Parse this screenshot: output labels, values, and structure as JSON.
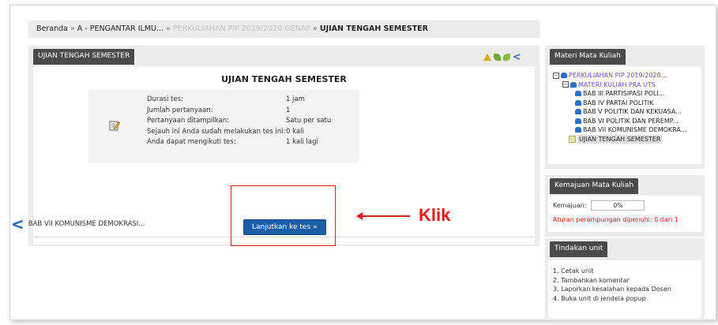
{
  "breadcrumb": {
    "home": "Beranda",
    "sep": "»",
    "course": "A - PENGANTAR ILMU...",
    "period": "PERKULIAHAN PIP 2019/2020 GENAP",
    "current": "UJIAN TENGAH SEMESTER"
  },
  "main": {
    "tab_label": "UJIAN TENGAH SEMESTER",
    "title": "UJIAN TENGAH SEMESTER",
    "info_rows": [
      {
        "label": "Durasi tes:",
        "value": "1 jam"
      },
      {
        "label": "Jumlah pertanyaan:",
        "value": "1"
      },
      {
        "label": "Pertanyaan ditampilkan:",
        "value": "Satu per satu"
      },
      {
        "label": "Sejauh ini Anda sudah melakukan tes ini:",
        "value": "0 kali"
      },
      {
        "label": "Anda dapat mengikuti tes:",
        "value": "1 kali lagi"
      }
    ],
    "start_button": "Lanjutkan ke tes »",
    "prev_link": "BAB VII KOMUNISME DEMOKRASI..."
  },
  "annotation": {
    "text": "Klik",
    "color": "#e31b1b"
  },
  "sidebar": {
    "materials_title": "Materi Mata Kuliah",
    "tree": {
      "root": "PERKULIAHAN PIP 2019/2020...",
      "folder": "MATERI KULIAH PRA UTS",
      "items": [
        "BAB III PARTISIPASI POLI...",
        "BAB IV PARTAI POLITIK",
        "BAB V POLITIK DAN KEKUASA...",
        "BAB VI POLITIK DAN PEREMP...",
        "BAB VII KOMUNISME DEMOKRA..."
      ],
      "current": "UJIAN TENGAH SEMESTER"
    },
    "progress_title": "Kemajuan Mata Kuliah",
    "progress_label": "Kemajuan:",
    "progress_value": "0%",
    "progress_rule": "Aturan perampungan dipenuhi: 0 dari 1",
    "actions_title": "Tindakan unit",
    "actions": [
      "1. Cetak unit",
      "2. Tambahkan komentar",
      "3. Laporkan kesalahan kepada Dosen",
      "4. Buka unit di jendela popup"
    ]
  },
  "colors": {
    "accent": "#1b5ea8",
    "header_tab": "#4a4a4a",
    "annotation": "#e31b1b"
  }
}
